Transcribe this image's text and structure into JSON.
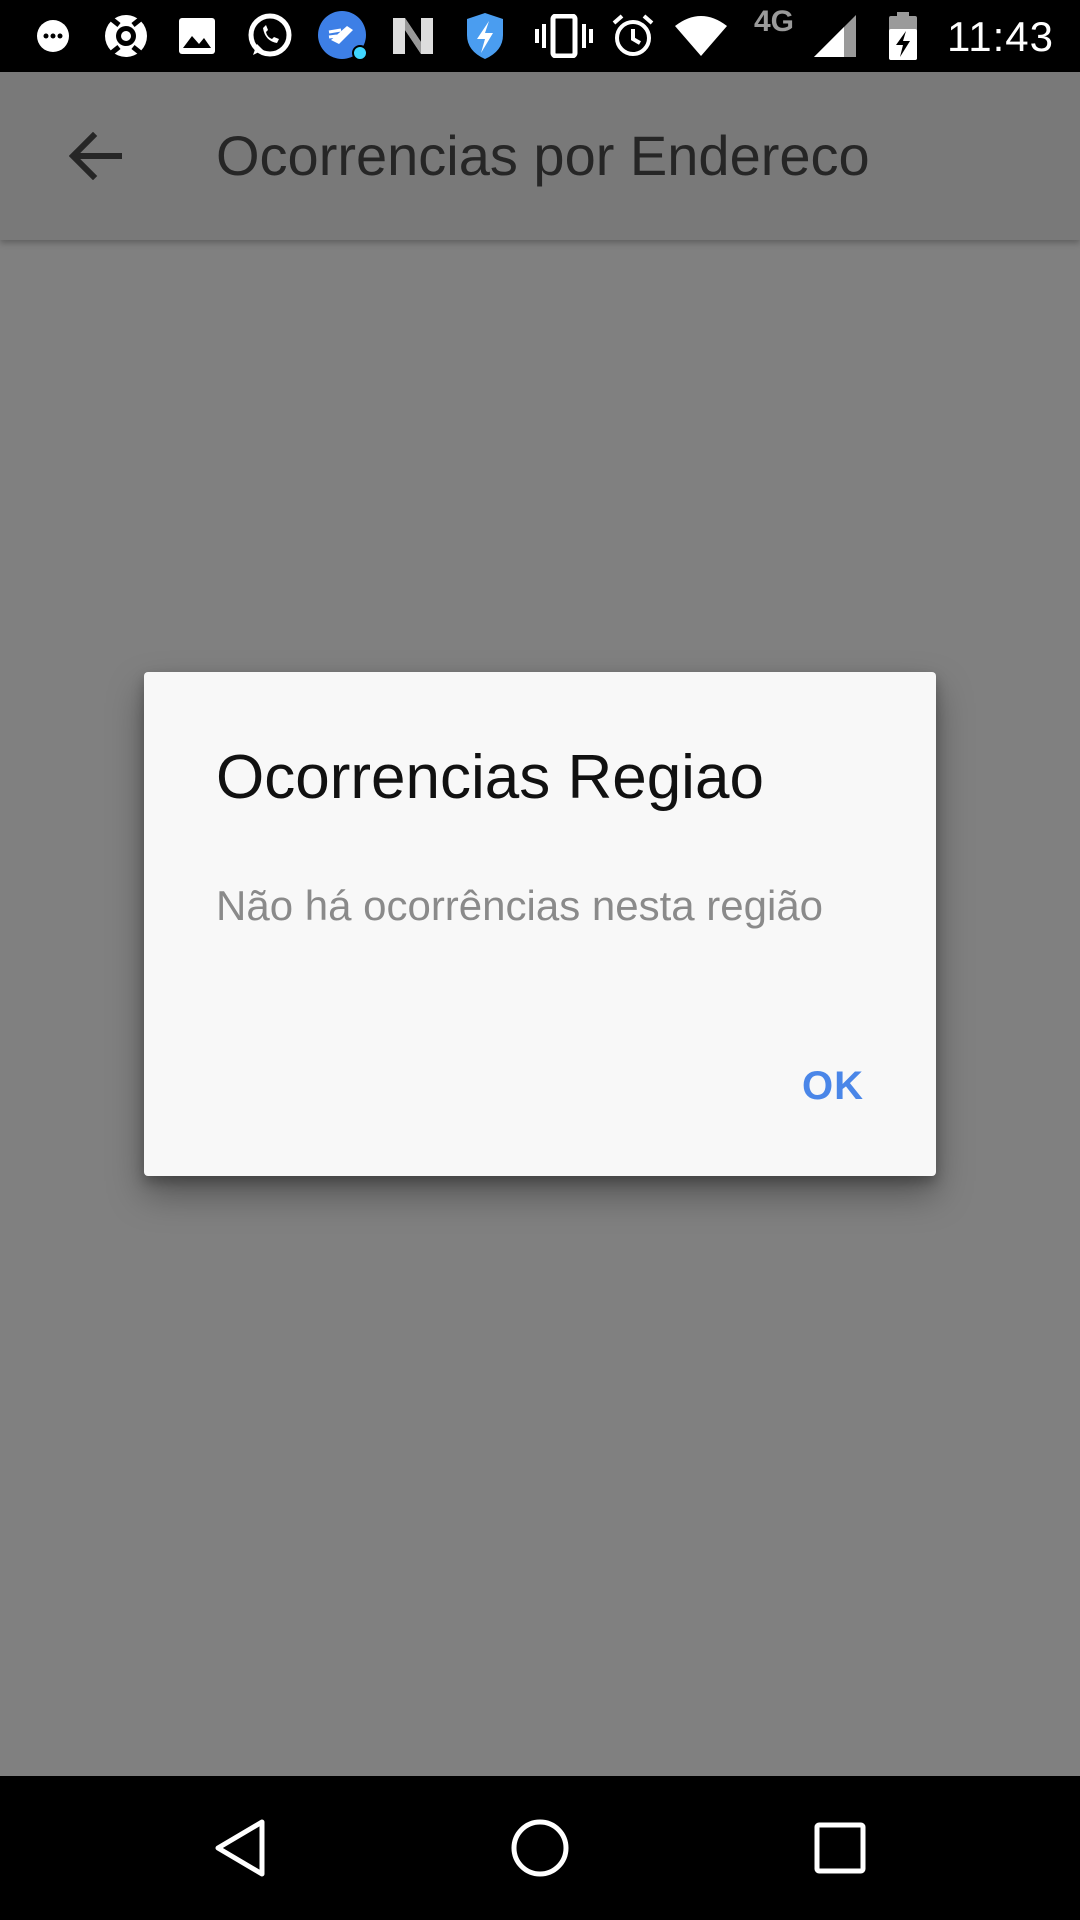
{
  "status_bar": {
    "time": "11:43",
    "network_label": "4G",
    "icons": [
      "chat-bubble-icon",
      "avast-icon",
      "gallery-icon",
      "whatsapp-icon",
      "cleaner-icon",
      "n-app-icon",
      "shield-icon",
      "vibrate-icon",
      "alarm-icon",
      "wifi-icon",
      "signal-icon",
      "battery-charging-icon"
    ]
  },
  "app_bar": {
    "title": "Ocorrencias por Endereco"
  },
  "dialog": {
    "title": "Ocorrencias Regiao",
    "message": "Não há ocorrências nesta região",
    "ok_label": "OK"
  },
  "colors": {
    "scrim": "#808080",
    "accent": "#4a86e8",
    "dialog_bg": "#f8f8f8"
  }
}
